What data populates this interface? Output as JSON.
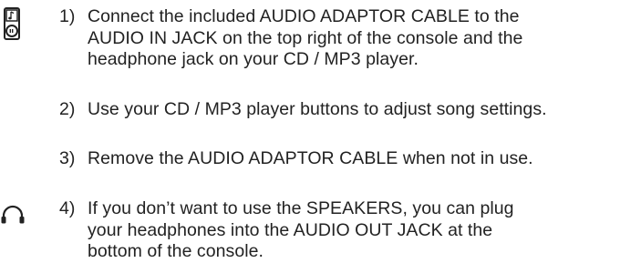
{
  "steps": [
    {
      "number": "1)",
      "lines": [
        "Connect the included AUDIO ADAPTOR CABLE to the",
        "AUDIO IN JACK on the top right of the console and the",
        "headphone jack on your CD / MP3 player."
      ],
      "icon": "mp3-player-icon"
    },
    {
      "number": "2)",
      "lines": [
        "Use your CD / MP3 player buttons to adjust song settings."
      ]
    },
    {
      "number": "3)",
      "lines": [
        "Remove the AUDIO ADAPTOR CABLE when not in use."
      ]
    },
    {
      "number": "4)",
      "lines": [
        "If you don’t want to use the SPEAKERS, you can plug",
        "your headphones into the AUDIO OUT JACK at the",
        "bottom of the console."
      ],
      "icon": "headphones-icon"
    }
  ]
}
